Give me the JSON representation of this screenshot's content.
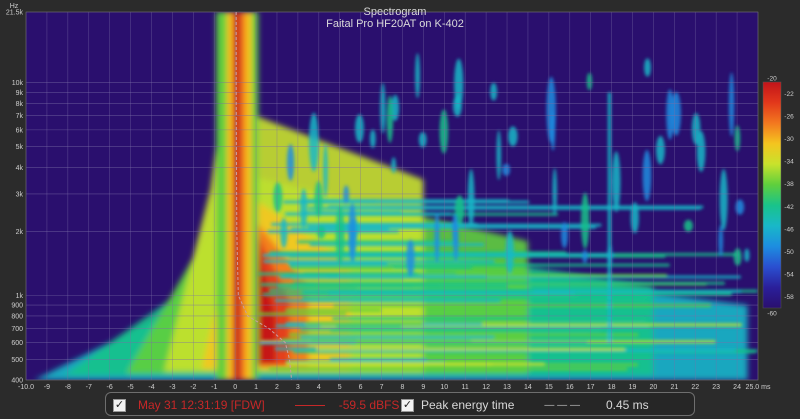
{
  "chart_data": {
    "type": "heatmap",
    "title": "Spectrogram",
    "subtitle": "Faital Pro HF20AT on K-402",
    "y_unit": "Hz",
    "x_unit": "ms",
    "xlim": [
      -10.0,
      25.0
    ],
    "ylim": [
      400,
      21500
    ],
    "y_scale": "log",
    "x_ticks": [
      "-10.0",
      "-9",
      "-8",
      "-7",
      "-6",
      "-5",
      "-4",
      "-3",
      "-2",
      "-1",
      "0",
      "1",
      "2",
      "3",
      "4",
      "5",
      "6",
      "7",
      "8",
      "9",
      "10",
      "11",
      "12",
      "13",
      "14",
      "15",
      "16",
      "17",
      "18",
      "19",
      "20",
      "21",
      "22",
      "23",
      "24",
      "25.0 ms"
    ],
    "y_ticks": [
      {
        "value": 21500,
        "label": "21.5k"
      },
      {
        "value": 10000,
        "label": "10k"
      },
      {
        "value": 9000,
        "label": "9k"
      },
      {
        "value": 8000,
        "label": "8k"
      },
      {
        "value": 7000,
        "label": "7k"
      },
      {
        "value": 6000,
        "label": "6k"
      },
      {
        "value": 5000,
        "label": "5k"
      },
      {
        "value": 4000,
        "label": "4k"
      },
      {
        "value": 3000,
        "label": "3k"
      },
      {
        "value": 2000,
        "label": "2k"
      },
      {
        "value": 1000,
        "label": "1k"
      },
      {
        "value": 900,
        "label": "900"
      },
      {
        "value": 800,
        "label": "800"
      },
      {
        "value": 700,
        "label": "700"
      },
      {
        "value": 600,
        "label": "600"
      },
      {
        "value": 500,
        "label": "500"
      },
      {
        "value": 400,
        "label": "400"
      }
    ],
    "colorbar": {
      "range": [
        -60,
        -20
      ],
      "ticks": [
        "-20",
        "-22",
        "-26",
        "-30",
        "-34",
        "-38",
        "-42",
        "-46",
        "-50",
        "-54",
        "-58",
        "-60"
      ]
    },
    "peak_energy_curve": [
      {
        "freq": 21500,
        "t": 0.05
      },
      {
        "freq": 10000,
        "t": 0.05
      },
      {
        "freq": 5000,
        "t": 0.06
      },
      {
        "freq": 2000,
        "t": 0.08
      },
      {
        "freq": 1000,
        "t": 0.15
      },
      {
        "freq": 800,
        "t": 0.6
      },
      {
        "freq": 700,
        "t": 1.6
      },
      {
        "freq": 600,
        "t": 2.4
      },
      {
        "freq": 500,
        "t": 2.6
      },
      {
        "freq": 400,
        "t": 2.7
      }
    ],
    "colors": {
      "background": "#2a0f6e",
      "grid": "#7d6fa8",
      "title": "#d9d9d9",
      "axis_text": "#cfcfcf",
      "colorbar_stops": [
        "#c2141a",
        "#e2381b",
        "#f3781f",
        "#f4c51f",
        "#c8e22c",
        "#5fcf3d",
        "#19c38a",
        "#19b8c8",
        "#1d8de0",
        "#2a4fd0",
        "#2a1f9a",
        "#2a0f6e"
      ]
    }
  },
  "legend": {
    "item1_checked": "✓",
    "item1_label": "May 31 12:31:19 [FDW]",
    "item1_value": "-59.5 dBFS",
    "item1_color": "#c62828",
    "item2_checked": "✓",
    "item2_label": "Peak energy time",
    "item2_line": "— — —",
    "item2_value": "0.45 ms"
  }
}
